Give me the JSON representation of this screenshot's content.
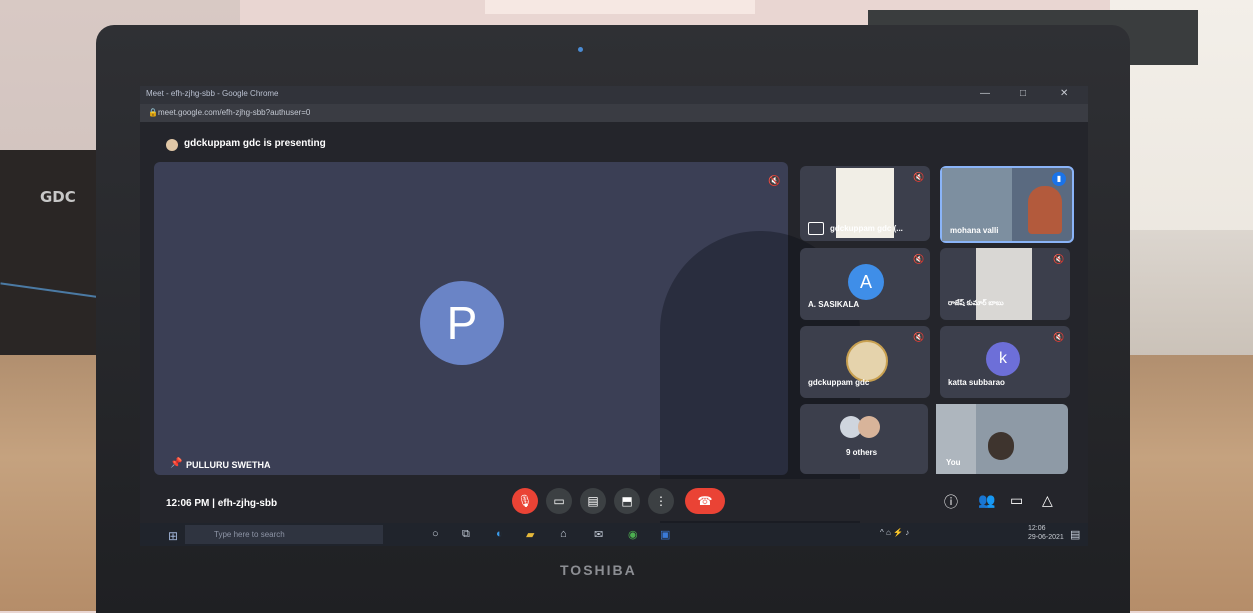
{
  "browser": {
    "window_title": "Meet - efh-zjhg-sbb - Google Chrome",
    "url": "meet.google.com/efh-zjhg-sbb?authuser=0",
    "controls": [
      "—",
      "□",
      "✕"
    ]
  },
  "meet": {
    "presenting_banner": "gdckuppam gdc is presenting",
    "main_tile": {
      "avatar_letter": "P",
      "name": "PULLURU SWETHA"
    },
    "tiles": [
      {
        "name": "gdckuppam gdc (...",
        "kind": "screen-share"
      },
      {
        "name": "mohana valli",
        "kind": "video"
      },
      {
        "name": "A. SASIKALA",
        "avatar_letter": "A",
        "avatar_color": "#3f8ee8"
      },
      {
        "name": "రాజేష్ కుమార్ బాబు",
        "kind": "video"
      },
      {
        "name": "gdckuppam gdc",
        "kind": "logo"
      },
      {
        "name": "katta subbarao",
        "avatar_letter": "k",
        "avatar_color": "#6d6fd8"
      },
      {
        "name": "9 others",
        "kind": "group"
      },
      {
        "name": "You",
        "kind": "self-video"
      }
    ],
    "bottom_bar": {
      "time_and_code": "12:06 PM  |  efh-zjhg-sbb"
    }
  },
  "taskbar": {
    "search_placeholder": "Type here to search",
    "clock_time": "12:06",
    "clock_date": "29-06-2021"
  },
  "laptop": {
    "brand": "TOSHIBA"
  },
  "room": {
    "cabinet_label": "GDC"
  },
  "colors": {
    "end_call": "#ea4335",
    "tile_bg": "#3c3f4c",
    "active_border": "#8ab4f8"
  }
}
